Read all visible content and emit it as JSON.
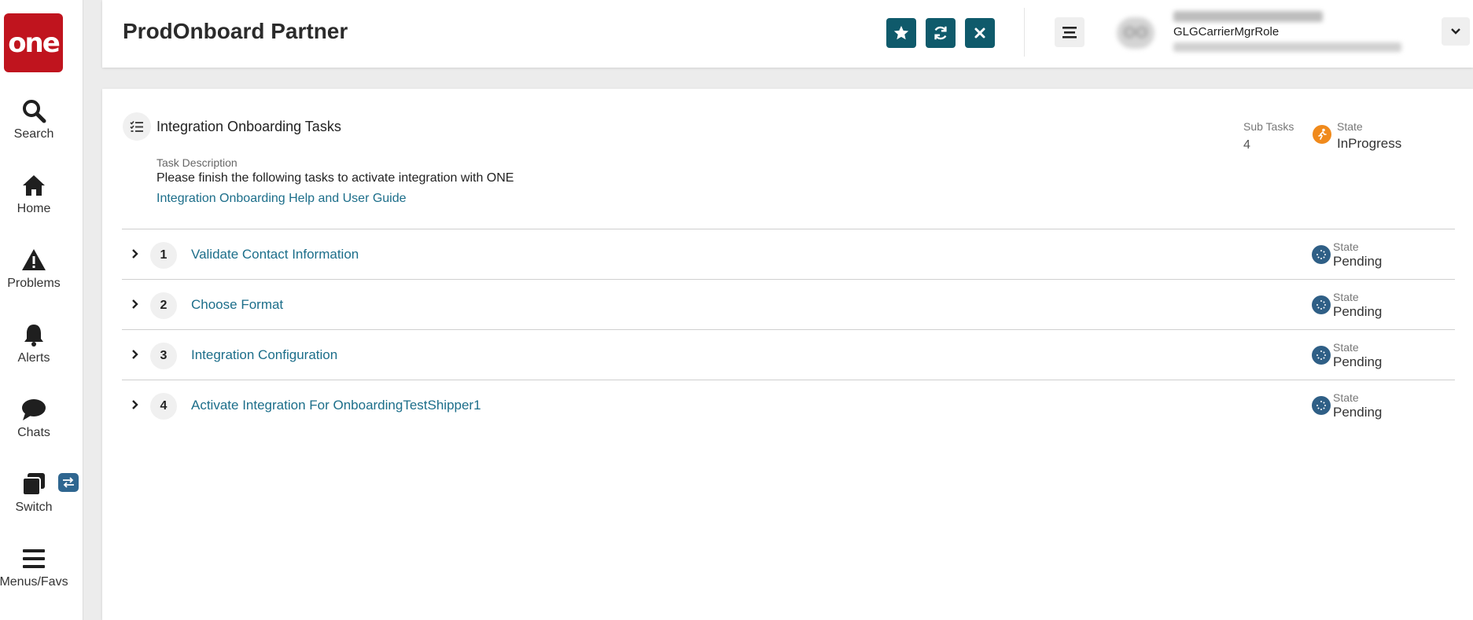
{
  "logo": {
    "text": "one"
  },
  "sidebar": {
    "items": [
      {
        "label": "Search"
      },
      {
        "label": "Home"
      },
      {
        "label": "Problems"
      },
      {
        "label": "Alerts"
      },
      {
        "label": "Chats"
      },
      {
        "label": "Switch"
      },
      {
        "label": "Menus/Favs"
      }
    ]
  },
  "header": {
    "title": "ProdOnboard Partner",
    "user_role": "GLGCarrierMgrRole",
    "avatar_initials": "OO"
  },
  "task": {
    "title": "Integration Onboarding Tasks",
    "description_label": "Task Description",
    "description": "Please finish the following tasks to activate integration with ONE",
    "help_link": "Integration Onboarding Help and User Guide",
    "subtasks_label": "Sub Tasks",
    "subtasks_value": "4",
    "state_label": "State",
    "state_value": "InProgress"
  },
  "subtasks": [
    {
      "number": "1",
      "title": "Validate Contact Information",
      "state_label": "State",
      "state": "Pending"
    },
    {
      "number": "2",
      "title": "Choose Format",
      "state_label": "State",
      "state": "Pending"
    },
    {
      "number": "3",
      "title": "Integration Configuration",
      "state_label": "State",
      "state": "Pending"
    },
    {
      "number": "4",
      "title": "Activate Integration For OnboardingTestShipper1",
      "state_label": "State",
      "state": "Pending"
    }
  ],
  "colors": {
    "brand_red": "#c0141e",
    "header_button": "#0f5a6b",
    "link": "#1c6e8a",
    "in_progress": "#f08a1c",
    "pending": "#2f5f86"
  }
}
